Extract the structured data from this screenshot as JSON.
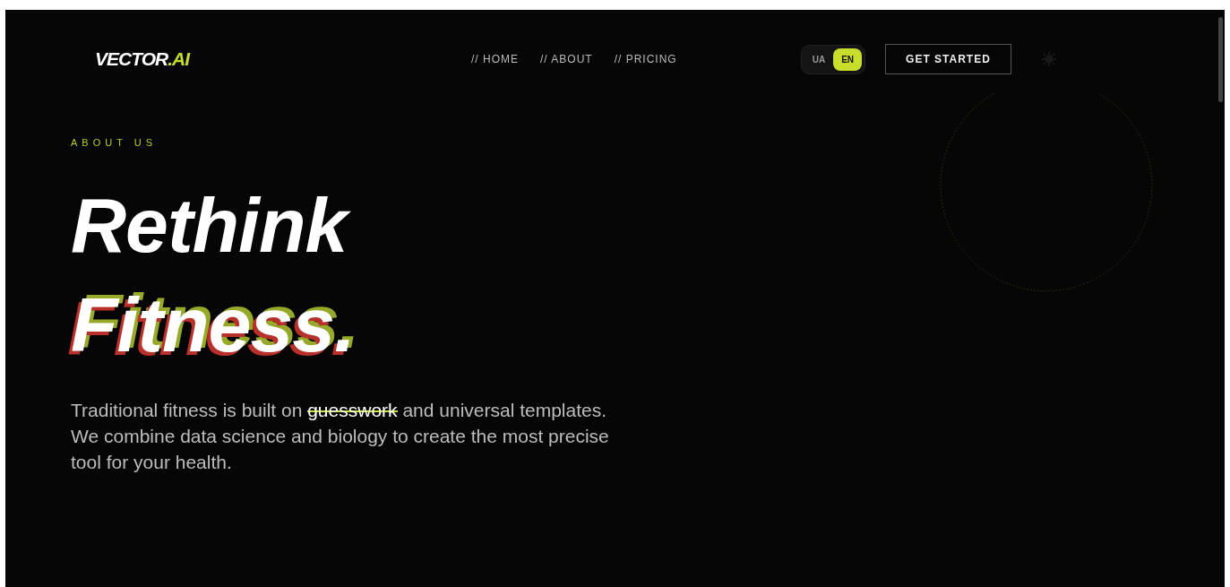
{
  "logo": {
    "text": "VECTOR",
    "accent": ".AI"
  },
  "nav": [
    {
      "label": "// HOME"
    },
    {
      "label": "// ABOUT"
    },
    {
      "label": "// PRICING"
    }
  ],
  "languages": [
    {
      "label": "UA",
      "selected": false
    },
    {
      "label": "EN",
      "selected": true
    }
  ],
  "cta": {
    "label": "GET STARTED"
  },
  "hero": {
    "eyebrow": "ABOUT US",
    "title_line_1": "Rethink",
    "title_line_2": "Fitness.",
    "paragraph": {
      "before": "Traditional fitness is built on ",
      "struck": "guesswork",
      "after": " and universal templates. We combine data science and biology to create the most precise tool for your health."
    }
  }
}
